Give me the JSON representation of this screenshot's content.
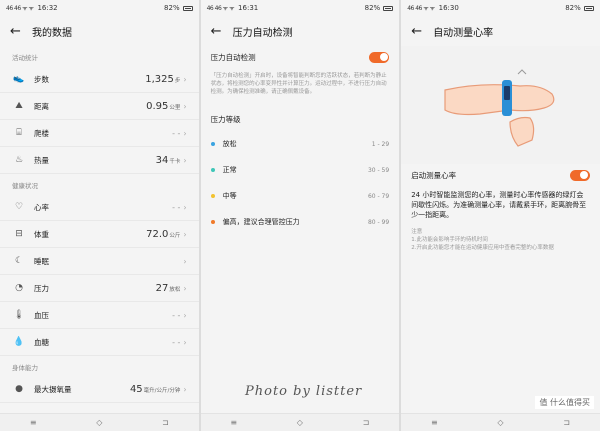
{
  "status": {
    "p1": {
      "carrier": "46 46 ᯤ ᯤ",
      "time": "16:32",
      "battery": "82%"
    },
    "p2": {
      "carrier": "46 46 ᯤ ᯤ",
      "time": "16:31",
      "battery": "82%"
    },
    "p3": {
      "carrier": "46 46 ᯤ ᯤ",
      "time": "16:30",
      "battery": "82%"
    }
  },
  "p1": {
    "title": "我的数据",
    "sections": {
      "activity": "活动统计",
      "health": "健康状况",
      "fitness": "身体能力"
    },
    "rows": {
      "steps": {
        "label": "步数",
        "value": "1,325",
        "unit": "步"
      },
      "distance": {
        "label": "距离",
        "value": "0.95",
        "unit": "公里"
      },
      "floors": {
        "label": "爬楼",
        "value": "- -"
      },
      "calories": {
        "label": "热量",
        "value": "34",
        "unit": "千卡"
      },
      "heart": {
        "label": "心率",
        "value": "- -"
      },
      "weight": {
        "label": "体重",
        "value": "72.0",
        "unit": "公斤"
      },
      "sleep": {
        "label": "睡眠",
        "value": ""
      },
      "stress": {
        "label": "压力",
        "value": "27",
        "unit": "放松"
      },
      "bp": {
        "label": "血压",
        "value": "- -"
      },
      "glucose": {
        "label": "血糖",
        "value": "- -"
      },
      "vo2": {
        "label": "最大摄氧量",
        "value": "45",
        "unit": "毫升/公斤/分钟"
      }
    }
  },
  "p2": {
    "title": "压力自动检测",
    "toggle_label": "压力自动检测",
    "toggle_on": true,
    "desc": "「压力自动检测」开启时，设备将智能判断您的活跃状态，若判断为静止状态，将检测您的心率变异性并计算压力。运动过程中，不进行压力自动检测。为确保检测准确，请正确佩戴设备。",
    "level_title": "压力等级",
    "levels": [
      {
        "name": "放松",
        "range": "1 - 29",
        "color": "#3aa3e0"
      },
      {
        "name": "正常",
        "range": "30 - 59",
        "color": "#3fc6b8"
      },
      {
        "name": "中等",
        "range": "60 - 79",
        "color": "#f2c230"
      },
      {
        "name": "偏高，建议合理管控压力",
        "range": "80 - 99",
        "color": "#f07a2a"
      }
    ]
  },
  "p3": {
    "title": "自动测量心率",
    "toggle_label": "启动测量心率",
    "toggle_on": true,
    "desc": "24 小时智能监测您的心率，测量时心率传感器的绿灯会间歇性闪烁。为准确测量心率，请戴紧手环，距离腕骨至少一指距离。",
    "note_title": "注意",
    "note1": "1.此功能会影响手环的待机时间",
    "note2": "2.开启此功能您才能在运动健康应用中查看完整的心率数据"
  },
  "watermark": "Photo  by  listter",
  "brand": "值 什么值得买"
}
